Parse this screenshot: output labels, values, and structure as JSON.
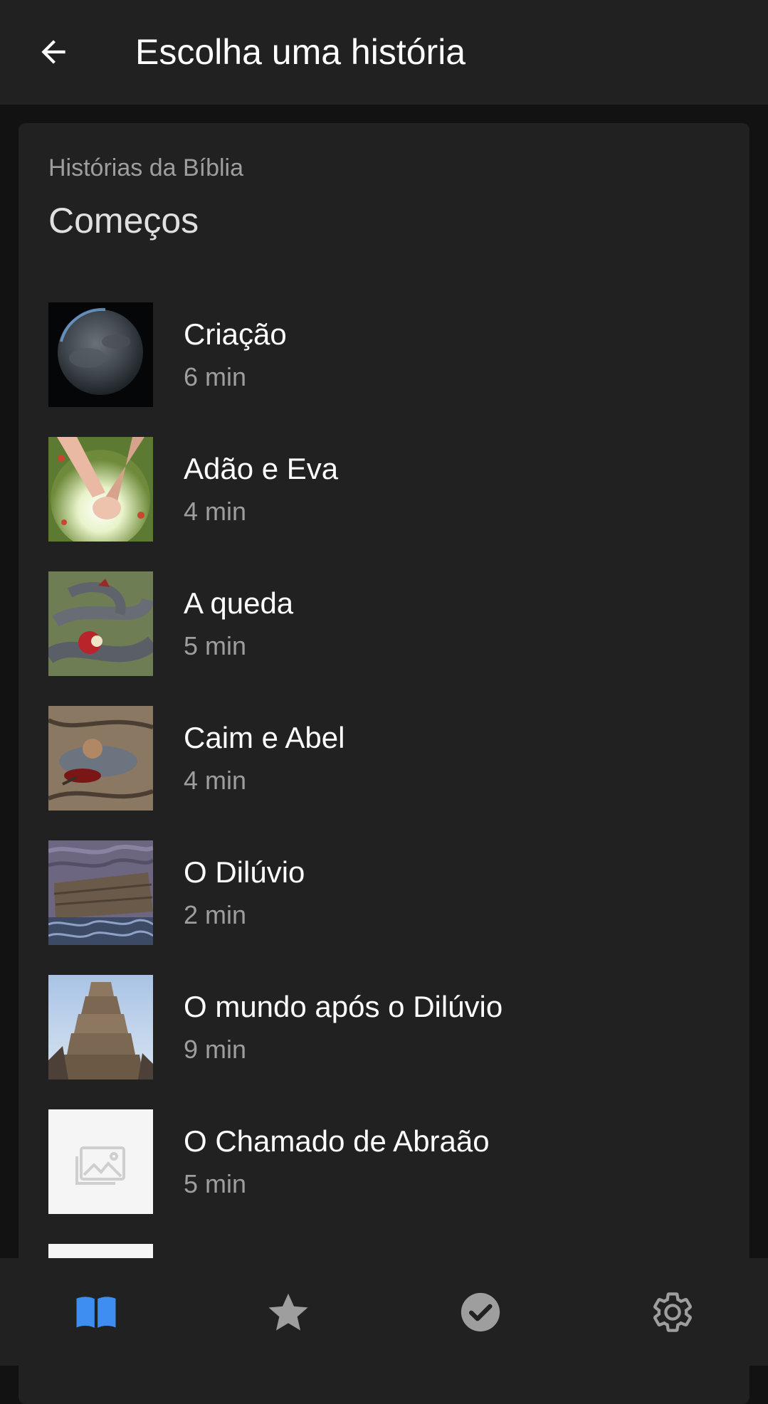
{
  "app_bar": {
    "back_icon": "arrow-left-icon",
    "title": "Escolha uma história"
  },
  "card": {
    "subtitle": "Histórias da Bíblia",
    "section_title": "Começos"
  },
  "stories": [
    {
      "name": "Criação",
      "duration": "6 min",
      "thumb": "planet-thumbnail"
    },
    {
      "name": "Adão e Eva",
      "duration": "4 min",
      "thumb": "holding-hands-thumbnail"
    },
    {
      "name": "A queda",
      "duration": "5 min",
      "thumb": "serpent-apple-thumbnail"
    },
    {
      "name": "Caim e Abel",
      "duration": "4 min",
      "thumb": "fallen-man-thumbnail"
    },
    {
      "name": "O Dilúvio",
      "duration": "2 min",
      "thumb": "ark-storm-thumbnail"
    },
    {
      "name": "O mundo após o Dilúvio",
      "duration": "9 min",
      "thumb": "tower-babel-thumbnail"
    },
    {
      "name": "O Chamado de Abraão",
      "duration": "5 min",
      "thumb": "image-placeholder-thumbnail"
    },
    {
      "name": "",
      "duration": "",
      "thumb": "image-placeholder-thumbnail"
    }
  ],
  "bottom_nav": [
    {
      "icon": "book-open-icon",
      "active": true
    },
    {
      "icon": "star-icon",
      "active": false
    },
    {
      "icon": "check-circle-icon",
      "active": false
    },
    {
      "icon": "settings-gear-icon",
      "active": false
    }
  ],
  "colors": {
    "background": "#121212",
    "surface": "#212121",
    "primary_text": "#ffffff",
    "secondary_text": "#9e9e9e",
    "accent": "#3d8ef0",
    "inactive_icon": "#9e9e9e"
  }
}
